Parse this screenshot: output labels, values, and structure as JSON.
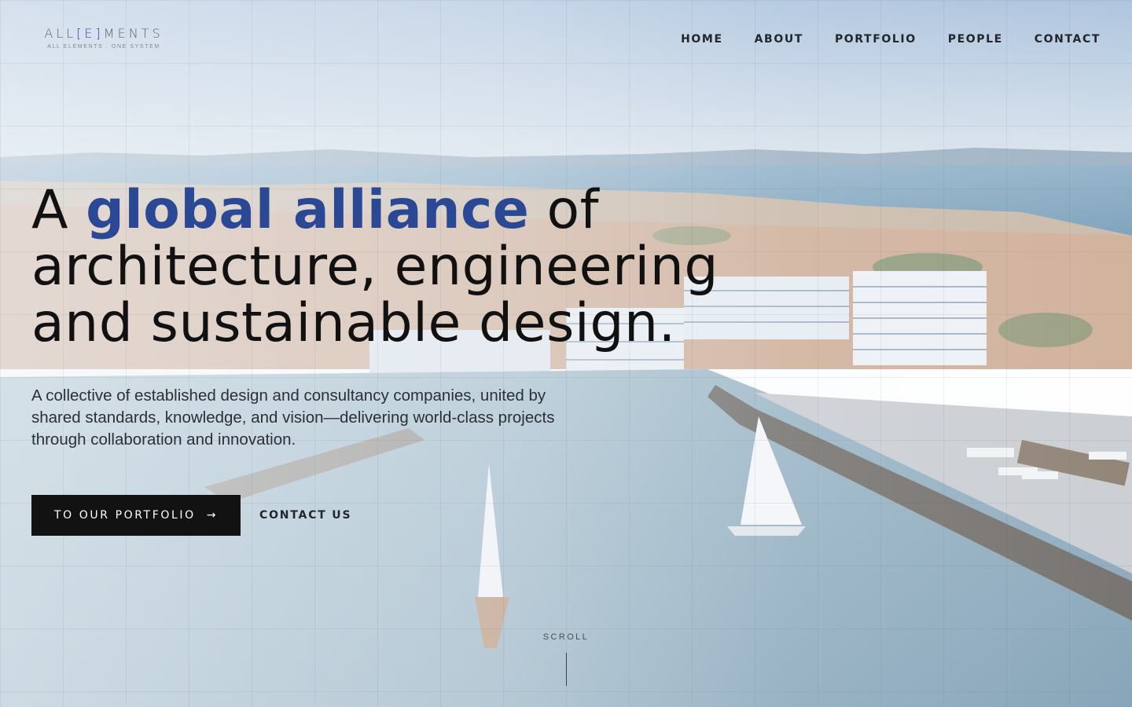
{
  "header": {
    "logo": {
      "left": "ALL",
      "bracket_open": "[",
      "accent": "E",
      "bracket_close": "]",
      "right": "MENTS",
      "tagline": "ALL ELEMENTS . ONE SYSTEM"
    },
    "nav": [
      {
        "label": "HOME"
      },
      {
        "label": "ABOUT"
      },
      {
        "label": "PORTFOLIO"
      },
      {
        "label": "PEOPLE"
      },
      {
        "label": "CONTACT"
      }
    ]
  },
  "hero": {
    "headline_start": "A ",
    "headline_highlight": "global alliance",
    "headline_end": " of architecture, engineering and sustainable design.",
    "subtext": "A collective of established design and consultancy companies, united by shared standards, knowledge, and vision—delivering world-class projects through collaboration and innovation.",
    "primary_cta": "TO OUR PORTFOLIO",
    "primary_cta_arrow": "→",
    "secondary_cta": "CONTACT US"
  },
  "scroll": {
    "label": "SCROLL"
  },
  "colors": {
    "accent": "#2a4894",
    "button_bg": "#121212",
    "text": "#111111"
  }
}
